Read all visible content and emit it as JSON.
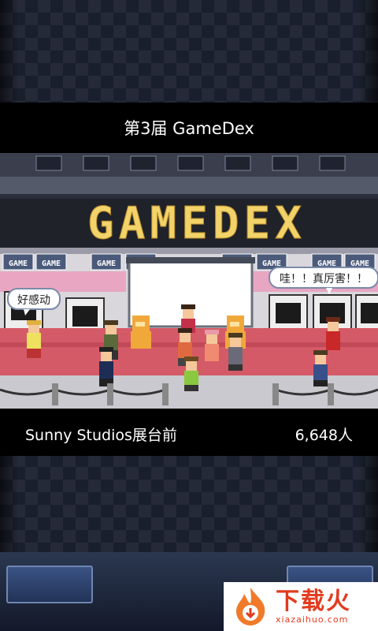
{
  "header": {
    "title": "第3届 GameDex"
  },
  "scene": {
    "banner_text": "GAMEDEX",
    "booth_sign_text": "GAME",
    "bubble_left": "好感动",
    "bubble_right": "哇！！真厉害！！"
  },
  "footer": {
    "studio_label": "Sunny Studios展台前",
    "visitor_count": "6,648人"
  },
  "watermark": {
    "title": "下载火",
    "url": "xiazaihuo.com"
  },
  "colors": {
    "accent_red": "#e23b1f",
    "banner_yellow": "#f2d36a",
    "carpet_red": "#d55a67",
    "button_blue": "#3a5384"
  }
}
